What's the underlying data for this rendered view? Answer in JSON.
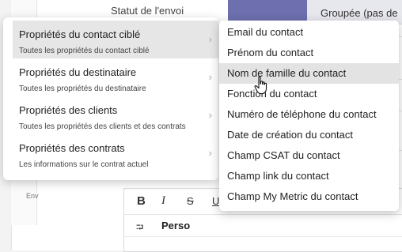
{
  "background": {
    "tab_left": "Statut de l'envoi",
    "tab_right": "Groupée (pas de",
    "env_label": "Env",
    "editor": {
      "bold": "B",
      "italic": "I",
      "strike": "S",
      "underline": "U",
      "wrap_icon": "⮒",
      "perso": "Perso"
    }
  },
  "categories": [
    {
      "title": "Propriétés du contact ciblé",
      "subtitle": "Toutes les propriétés du contact ciblé",
      "active": true
    },
    {
      "title": "Propriétés du destinataire",
      "subtitle": "Toutes les propriétés du destinataire",
      "active": false
    },
    {
      "title": "Propriétés des clients",
      "subtitle": "Toutes les propriétés des clients et des contrats",
      "active": false
    },
    {
      "title": "Propriétés des contrats",
      "subtitle": "Les informations sur le contrat actuel",
      "active": false
    }
  ],
  "submenu": [
    {
      "label": "Email du contact"
    },
    {
      "label": "Prénom du contact"
    },
    {
      "label": "Nom de famille du contact",
      "hover": true
    },
    {
      "label": "Fonction du contact"
    },
    {
      "label": "Numéro de téléphone du contact"
    },
    {
      "label": "Date de création du contact"
    },
    {
      "label": "Champ CSAT du contact"
    },
    {
      "label": "Champ link du contact"
    },
    {
      "label": "Champ My Metric du contact"
    }
  ],
  "colors": {
    "active_tab": "#6d6fae",
    "hover_bg": "#e3e3e3"
  },
  "icons": {
    "chevron": "chevron-right-icon",
    "cursor": "hand-pointer-icon"
  }
}
